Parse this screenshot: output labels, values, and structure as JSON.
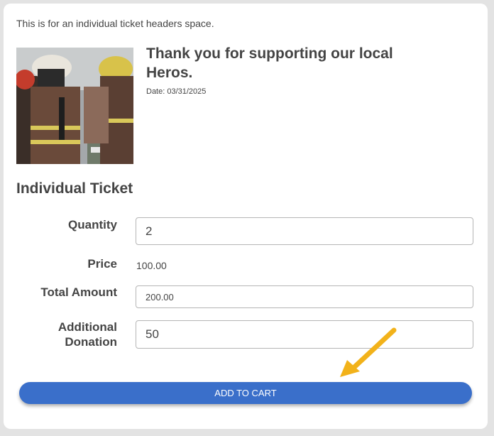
{
  "header_note": "This is for an individual ticket headers space.",
  "event": {
    "title": "Thank you for supporting our local Heros.",
    "date": "Date: 03/31/2025",
    "image_label": "firefighters-photo"
  },
  "ticket": {
    "section_title": "Individual Ticket",
    "quantity_label": "Quantity",
    "quantity_value": "2",
    "price_label": "Price",
    "price_value": "100.00",
    "total_label": "Total Amount",
    "total_value": "200.00",
    "donation_label_line1": "Additional",
    "donation_label_line2": "Donation",
    "donation_value": "50"
  },
  "actions": {
    "add_to_cart_label": "ADD TO CART"
  },
  "colors": {
    "button": "#3a6fca",
    "arrow": "#f2b21a",
    "background": "#e3e3e3"
  },
  "icons": {
    "pointer_arrow": "arrow-icon"
  }
}
